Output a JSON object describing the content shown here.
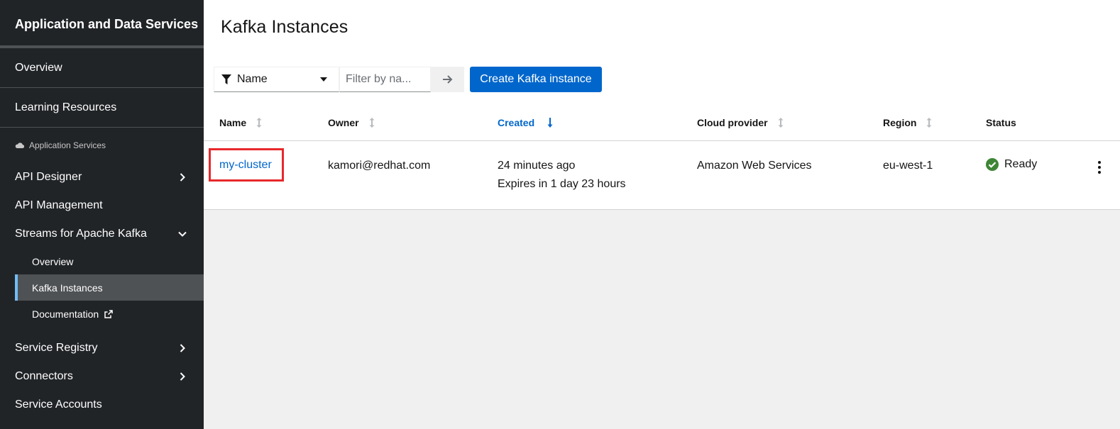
{
  "sidebar": {
    "header": "Application and Data Services",
    "top_items": [
      {
        "label": "Overview"
      },
      {
        "label": "Learning Resources"
      }
    ],
    "section_label": "Application Services",
    "groups": {
      "api_designer": "API Designer",
      "api_management": "API Management",
      "streams": "Streams for Apache Kafka",
      "streams_children": {
        "overview": "Overview",
        "kafka_instances": "Kafka Instances",
        "documentation": "Documentation"
      },
      "service_registry": "Service Registry",
      "connectors": "Connectors",
      "service_accounts": "Service Accounts"
    }
  },
  "page": {
    "title": "Kafka Instances"
  },
  "toolbar": {
    "filter_attribute": "Name",
    "filter_placeholder": "Filter by na...",
    "create_button": "Create Kafka instance"
  },
  "table": {
    "headers": {
      "name": "Name",
      "owner": "Owner",
      "created": "Created",
      "cloud_provider": "Cloud provider",
      "region": "Region",
      "status": "Status"
    },
    "rows": [
      {
        "name": "my-cluster",
        "owner": "kamori@redhat.com",
        "created": "24 minutes ago",
        "expires": "Expires in 1 day 23 hours",
        "cloud_provider": "Amazon Web Services",
        "region": "eu-west-1",
        "status": "Ready"
      }
    ]
  },
  "colors": {
    "sidebar_bg": "#212427",
    "accent": "#0066cc",
    "active_indicator": "#73bcf7",
    "status_ready": "#3e8635",
    "highlight": "#e8282b"
  },
  "icons": {
    "filter": "filter-icon",
    "caret": "caret-down-icon",
    "search": "arrow-right-icon",
    "cloud": "cloud-icon",
    "chevron_right": "chevron-right-icon",
    "chevron_down": "chevron-down-icon",
    "external_link": "external-link-icon",
    "check_circle": "check-circle-icon",
    "kebab": "kebab-icon",
    "sort": "sort-icon",
    "sort_down": "sort-down-icon"
  }
}
